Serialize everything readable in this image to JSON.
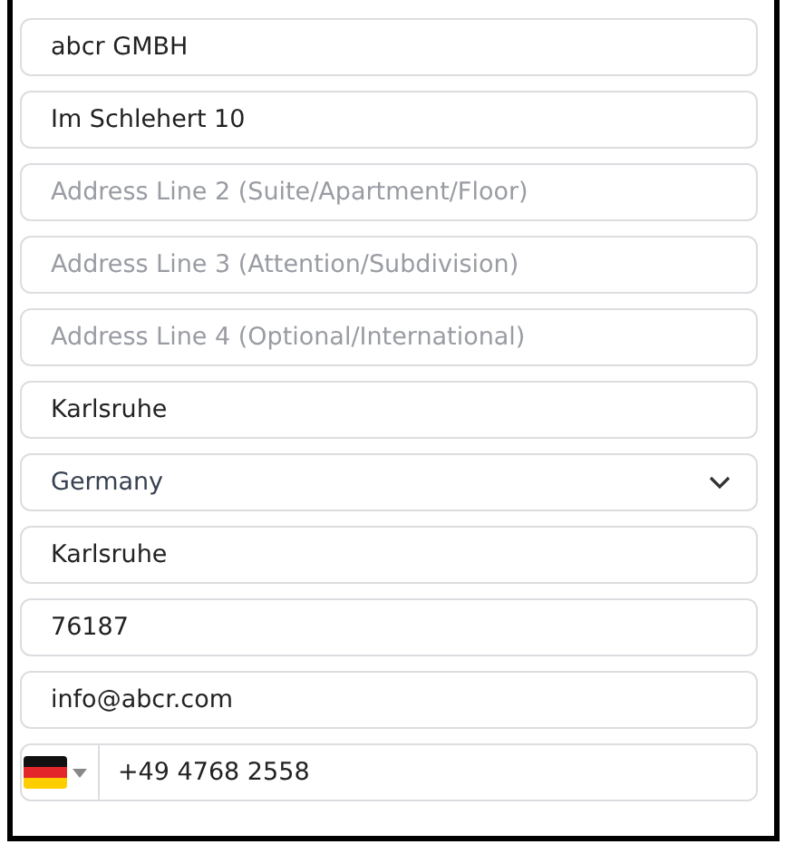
{
  "fields": [
    {
      "kind": "text",
      "value": "abcr GMBH"
    },
    {
      "kind": "text",
      "value": "Im Schlehert 10"
    },
    {
      "kind": "text",
      "placeholder": "Address Line 2 (Suite/Apartment/Floor)"
    },
    {
      "kind": "text",
      "placeholder": "Address Line 3 (Attention/Subdivision)"
    },
    {
      "kind": "text",
      "placeholder": "Address Line 4 (Optional/International)"
    },
    {
      "kind": "text",
      "value": "Karlsruhe"
    },
    {
      "kind": "select",
      "value": "Germany"
    },
    {
      "kind": "text",
      "value": "Karlsruhe"
    },
    {
      "kind": "text",
      "value": "76187"
    },
    {
      "kind": "text",
      "value": "info@abcr.com"
    },
    {
      "kind": "phone",
      "value": "+49 4768 2558"
    }
  ]
}
